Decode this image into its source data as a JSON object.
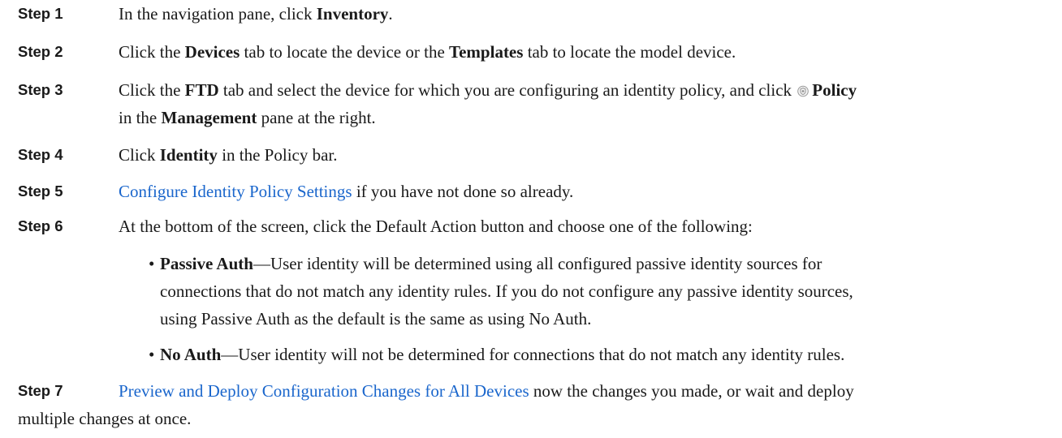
{
  "steps": [
    {
      "label": "Step 1",
      "parts": {
        "t1": "In the navigation pane, click ",
        "b1": "Inventory",
        "t2": "."
      }
    },
    {
      "label": "Step 2",
      "parts": {
        "t1": "Click the ",
        "b1": "Devices",
        "t2": " tab to locate the device or the ",
        "b2": "Templates",
        "t3": " tab to locate the model device."
      }
    },
    {
      "label": "Step 3",
      "parts": {
        "t1": "Click the ",
        "b1": "FTD",
        "t2": " tab and select the device for which you are configuring an identity policy, and click ",
        "b2": "Policy",
        "t3": "in the ",
        "b3": "Management",
        "t4": " pane at the right."
      }
    },
    {
      "label": "Step 4",
      "parts": {
        "t1": "Click ",
        "b1": "Identity",
        "t2": " in the Policy bar."
      }
    },
    {
      "label": "Step 5",
      "parts": {
        "link": "Configure Identity Policy Settings",
        "t1": " if you have not done so already."
      }
    },
    {
      "label": "Step 6",
      "parts": {
        "t1": "At the bottom of the screen, click the Default Action button and choose one of the following:"
      },
      "bullets": [
        {
          "term": "Passive Auth",
          "dash": "—",
          "line1": "User identity will be determined using all configured passive identity sources for",
          "line2": "connections that do not match any identity rules. If you do not configure any passive identity sources,",
          "line3": "using Passive Auth as the default is the same as using No Auth."
        },
        {
          "term": "No Auth",
          "dash": "—",
          "line1": "User identity will not be determined for connections that do not match any identity rules."
        }
      ]
    },
    {
      "label": "Step 7",
      "parts": {
        "link": "Preview and Deploy Configuration Changes for All Devices",
        "t1": " now the changes you made, or wait and deploy",
        "t2": "multiple changes at once."
      }
    }
  ],
  "colors": {
    "link": "#1a66cc",
    "text": "#1a1a1a"
  },
  "icons": {
    "policy": "shield-icon"
  }
}
